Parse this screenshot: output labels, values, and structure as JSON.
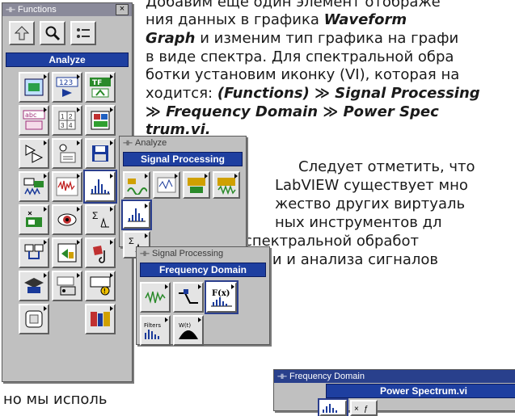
{
  "paragraph1": {
    "line1": "Добавим еще один элемент отображе",
    "line2_a": "ния данных в графика ",
    "line2_b": "Waveform",
    "line3_a": "Graph",
    "line3_b": " и изменим тип графика на графи",
    "line4": "в виде спектра. Для спектральной обра",
    "line5": "ботки установим иконку (VI), которая на",
    "line6_a": "ходится: ",
    "line6_b": "(Functions) ≫ Signal Processing",
    "line7": "≫ Frequency Domain ≫ Power Spec",
    "line8": "trum.vi."
  },
  "paragraph2": {
    "line1": "Следует отметить, что",
    "line2": "LabVIEW существует мно",
    "line3": "жество других виртуаль",
    "line4": "ных инструментов дл",
    "line5": "спектральной обработ",
    "line6": "ки и анализа сигналов"
  },
  "bottom_fragment": "но мы исполь",
  "functions_palette": {
    "title": "Functions",
    "close_glyph": "×",
    "category": "Analyze",
    "toolbar": [
      "up-arrow-icon",
      "search-icon",
      "options-icon"
    ],
    "icon_numeric": "123",
    "icon_tf": "TF",
    "icon_abc": "abc"
  },
  "analyze_palette": {
    "title": "Analyze",
    "category": "Signal Processing"
  },
  "signal_processing_palette": {
    "title": "Signal Processing",
    "category": "Frequency Domain",
    "fx_label": "F(x)",
    "filters_label": "Filters",
    "window_label": "W(t)"
  },
  "frequency_domain_palette": {
    "title": "Frequency Domain",
    "category": "Power Spectrum.vi"
  },
  "colors": {
    "header_blue": "#1e3fa0",
    "titlebar_blue": "#29408c",
    "palette_gray": "#c0c0c0"
  }
}
